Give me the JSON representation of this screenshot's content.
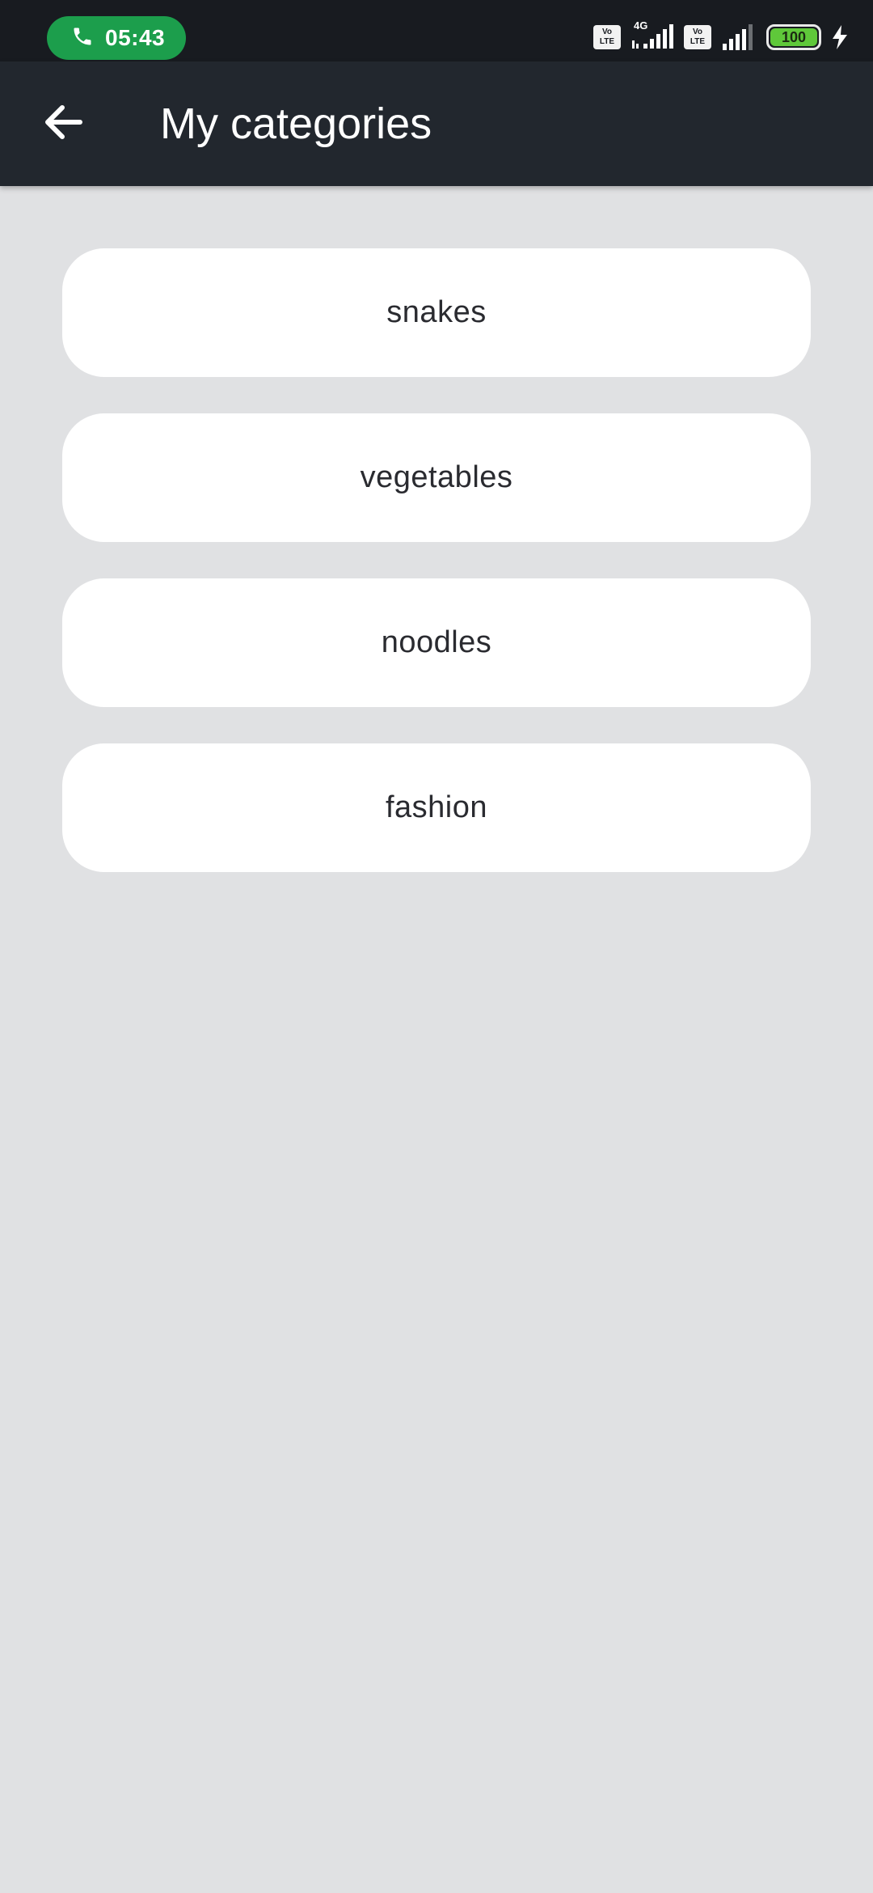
{
  "status_bar": {
    "call_time": "05:43",
    "network_left": "VoLTE",
    "network_type": "4G",
    "network_right": "VoLTE",
    "battery_level": "100",
    "colors": {
      "background": "#181b20",
      "call_pill": "#1c9e4c",
      "battery_fill": "#5fc83a"
    },
    "icons": [
      "phone-icon",
      "volte-icon",
      "signal-icon",
      "battery-icon",
      "charging-icon"
    ]
  },
  "app_bar": {
    "title": "My categories",
    "back_icon": "arrow-left-icon",
    "background": "#22272e"
  },
  "categories": [
    {
      "label": "snakes"
    },
    {
      "label": "vegetables"
    },
    {
      "label": "noodles"
    },
    {
      "label": "fashion"
    }
  ],
  "colors": {
    "page_background": "#e0e1e3",
    "card_background": "#ffffff",
    "card_text": "#2a2b30"
  }
}
